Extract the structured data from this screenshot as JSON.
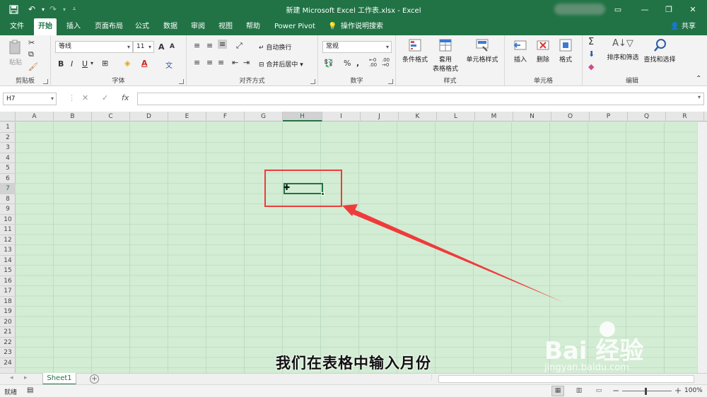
{
  "window": {
    "title": "新建 Microsoft Excel 工作表.xlsx  -  Excel",
    "controls": [
      "▭",
      "—",
      "❐",
      "✕"
    ]
  },
  "quick_access": {
    "save_icon": "save-icon",
    "undo_icon": "undo-icon",
    "redo_icon": "redo-icon",
    "customize_icon": "customize-icon"
  },
  "menu": {
    "tabs": [
      "文件",
      "开始",
      "插入",
      "页面布局",
      "公式",
      "数据",
      "审阅",
      "视图",
      "帮助",
      "Power Pivot",
      "操作说明搜索"
    ],
    "active": "开始",
    "share": "共享"
  },
  "ribbon": {
    "clipboard": {
      "label": "剪贴板",
      "paste": "粘贴"
    },
    "font": {
      "label": "字体",
      "name": "等线",
      "size": "11",
      "grow": "A",
      "shrink": "A",
      "bold": "B",
      "italic": "I",
      "underline": "U",
      "phonetic": "文"
    },
    "alignment": {
      "label": "对齐方式",
      "wrap": "自动换行",
      "merge": "合并后居中"
    },
    "number": {
      "label": "数字",
      "format": "常规",
      "percent": "%",
      "comma": ",",
      "inc": ".0\n.00",
      "dec": ".00\n→.0"
    },
    "styles": {
      "label": "样式",
      "conditional": "条件格式",
      "table1": "套用",
      "table2": "表格格式",
      "cell_styles": "单元格样式"
    },
    "cells": {
      "label": "单元格",
      "insert": "插入",
      "delete": "删除",
      "format": "格式"
    },
    "editing": {
      "label": "编辑",
      "sort": "排序和筛选",
      "find": "查找和选择"
    }
  },
  "formula_bar": {
    "name_box": "H7",
    "cancel": "✕",
    "enter": "✓",
    "fx": "fx",
    "value": ""
  },
  "sheet": {
    "columns": [
      "A",
      "B",
      "C",
      "D",
      "E",
      "F",
      "G",
      "H",
      "I",
      "J",
      "K",
      "L",
      "M",
      "N",
      "O",
      "P",
      "Q",
      "R"
    ],
    "rows": [
      "1",
      "2",
      "3",
      "4",
      "5",
      "6",
      "7",
      "8",
      "9",
      "10",
      "11",
      "12",
      "13",
      "14",
      "15",
      "16",
      "17",
      "18",
      "19",
      "20",
      "21",
      "22",
      "23",
      "24"
    ],
    "active_column": "H",
    "active_row": "7",
    "tab": "Sheet1"
  },
  "caption": "我们在表格中输入月份",
  "watermark": {
    "brand": "Bai  经验",
    "url": "jingyan.baidu.com"
  },
  "status": {
    "ready": "就绪",
    "zoom": "100%",
    "zoom_minus": "−",
    "zoom_plus": "+"
  },
  "colors": {
    "accent": "#217346",
    "grid_bg": "#d3ecd4",
    "highlight": "#ef3b3b"
  }
}
